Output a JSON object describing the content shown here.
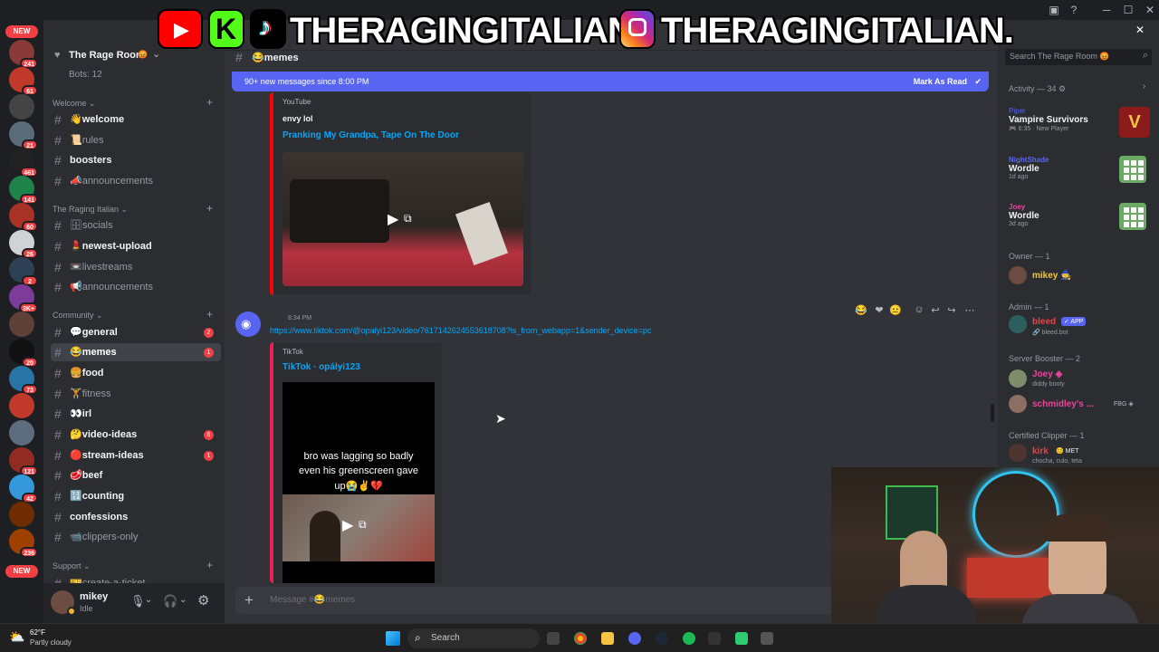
{
  "titlebar": {
    "minimize": "─",
    "maximize": "☐",
    "close": "✕"
  },
  "banner": {
    "handle_left": "THERAGINGITALIAN",
    "handle_right": "THERAGINGITALIAN.",
    "k_letter": "K"
  },
  "rail": {
    "new_label": "NEW",
    "badges": [
      "241",
      "61",
      "21",
      "461",
      "141",
      "60",
      "26",
      "2",
      "3K+",
      "20",
      "73",
      "121",
      "42",
      "236"
    ],
    "new_bottom": "NEW"
  },
  "sidebar": {
    "server_name": "The Rage Room",
    "server_emoji": "😡",
    "bots_label": "Bots: 12",
    "categories": {
      "welcome": "Welcome",
      "raging_italian": "The Raging Italian",
      "community": "Community",
      "support": "Support"
    },
    "channels": {
      "welcome": "👋welcome",
      "rules": "📜rules",
      "boosters": "boosters",
      "announcements1": "📣announcements",
      "socials": "🗄socials",
      "newest_upload": "💄newest-upload",
      "livestreams": "📼livestreams",
      "announcements2": "📢announcements",
      "general": "💬general",
      "memes": "😂memes",
      "food": "🍔food",
      "fitness": "🏋fitness",
      "irl": "👀irl",
      "video_ideas": "🤔video-ideas",
      "stream_ideas": "🔴stream-ideas",
      "beef": "🥩beef",
      "counting": "🔢counting",
      "confessions": "confessions",
      "clippers_only": "📹clippers-only",
      "create_ticket": "🎫create-a-ticket"
    },
    "badges": {
      "general": "2",
      "memes": "1",
      "video_ideas": "6",
      "stream_ideas": "1"
    }
  },
  "userpanel": {
    "name": "mikey",
    "status": "Idle"
  },
  "main": {
    "channel_name": "😂memes",
    "new_messages": "90+ new messages since 8:00 PM",
    "mark_as_read": "Mark As Read",
    "embed1": {
      "provider": "YouTube",
      "author": "envy lol",
      "title": "Pranking My Grandpa, Tape On The Door"
    },
    "message2": {
      "time": "8:34 PM",
      "link": "https://www.tiktok.com/@opalyi123/video/7617142624553618708?is_from_webapp=1&sender_device=pc"
    },
    "embed2": {
      "provider": "TikTok",
      "title": "TikTok · opályi123",
      "caption_line1": "bro was lagging so badly",
      "caption_line2": "even his greenscreen gave",
      "caption_line3": "up😭✌️💔"
    },
    "composer_placeholder": "Message #😂memes"
  },
  "header_right": {
    "search_placeholder": "Search The Rage Room 😡"
  },
  "members": {
    "activity_label": "Activity — 34 ⚙",
    "activities": [
      {
        "user": "Piper",
        "game": "Vampire Survivors",
        "meta": "🎮 6:35 · New Player"
      },
      {
        "user": "NightShade",
        "game": "Wordle",
        "meta": "1d ago"
      },
      {
        "user": "Joey",
        "game": "Wordle",
        "meta": "3d ago"
      }
    ],
    "owner_group": "Owner — 1",
    "owner": {
      "name": "mikey 🧙"
    },
    "admin_group": "Admin — 1",
    "admin": {
      "name": "bleed",
      "tag": "✓ APP",
      "sub": "🔗 bleed.bot"
    },
    "booster_group": "Server Booster — 2",
    "boosters": [
      {
        "name": "Joey ◈",
        "sub": "diddy booty"
      },
      {
        "name": "schmidley's ...",
        "tag": "FBG ◈"
      }
    ],
    "clipper_group": "Certified Clipper — 1",
    "clipper": {
      "name": "kirk",
      "tag": "😊 MET",
      "sub": "chocha, culo, teta"
    }
  },
  "taskbar": {
    "weather_temp": "62°F",
    "weather_desc": "Partly cloudy",
    "search_label": "Search"
  },
  "colors": {
    "accent": "#5865f2",
    "badge": "#f23f43",
    "link": "#00a8fc",
    "tiktok": "#ee1d52"
  }
}
